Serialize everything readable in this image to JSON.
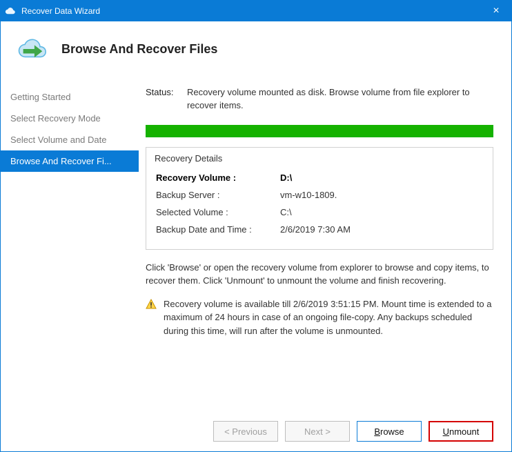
{
  "titlebar": {
    "title": "Recover Data Wizard",
    "close": "×"
  },
  "header": {
    "title": "Browse And Recover Files"
  },
  "sidebar": {
    "items": [
      {
        "label": "Getting Started",
        "selected": false
      },
      {
        "label": "Select Recovery Mode",
        "selected": false
      },
      {
        "label": "Select Volume and Date",
        "selected": false
      },
      {
        "label": "Browse And Recover Fi...",
        "selected": true
      }
    ]
  },
  "status": {
    "label": "Status:",
    "text": "Recovery volume mounted as disk. Browse volume from file explorer to recover items."
  },
  "details": {
    "title": "Recovery Details",
    "rows": [
      {
        "label": "Recovery Volume :",
        "value": "D:\\",
        "bold": true
      },
      {
        "label": "Backup Server :",
        "value": "vm-w10-1809."
      },
      {
        "label": "Selected Volume :",
        "value": "C:\\"
      },
      {
        "label": "Backup Date and Time :",
        "value": "2/6/2019 7:30 AM"
      }
    ]
  },
  "instruction": "Click 'Browse' or open the recovery volume from explorer to browse and copy items, to recover them. Click 'Unmount' to unmount the volume and finish recovering.",
  "warning": "Recovery volume is available till 2/6/2019 3:51:15 PM. Mount time is extended to a maximum of 24 hours in case of an ongoing file-copy. Any backups scheduled during this time, will run after the volume is unmounted.",
  "buttons": {
    "previous": "< Previous",
    "next": "Next >",
    "browse": "Browse",
    "unmount": "Unmount"
  },
  "colors": {
    "accent": "#0a7bd6",
    "progress": "#15b200",
    "highlight": "#d40000"
  }
}
